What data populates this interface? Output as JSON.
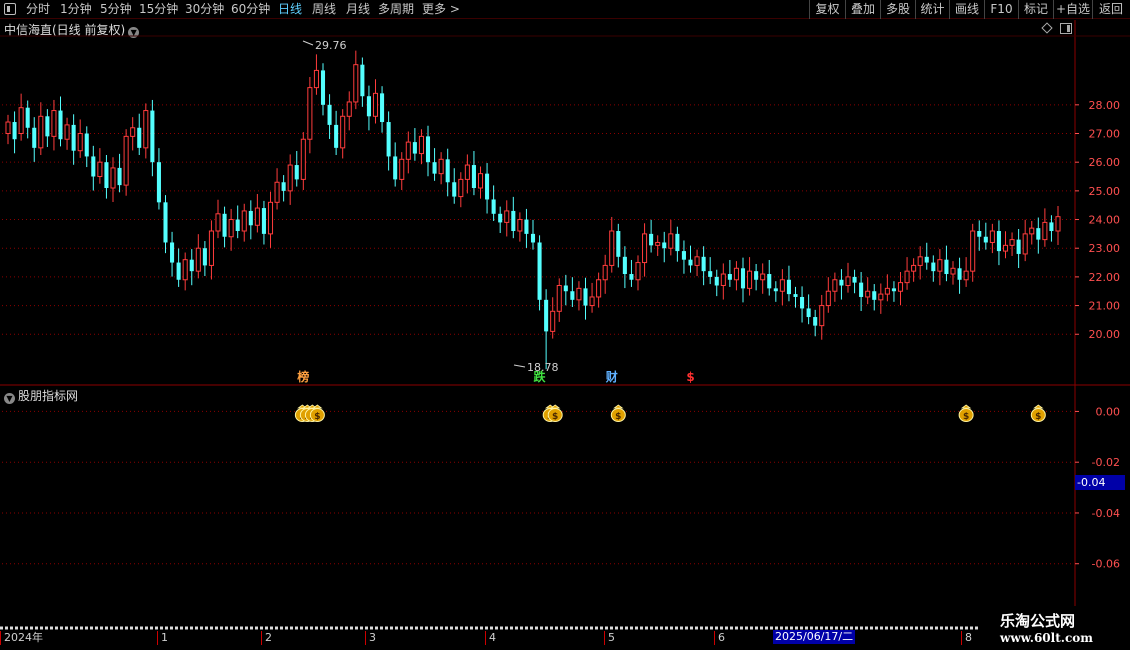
{
  "toolbar": {
    "periods": [
      "分时",
      "1分钟",
      "5分钟",
      "15分钟",
      "30分钟",
      "60分钟",
      "日线",
      "周线",
      "月线",
      "多周期",
      "更多 >"
    ],
    "active_period": "日线",
    "actions": [
      "复权",
      "叠加",
      "多股",
      "统计",
      "画线",
      "F10",
      "标记",
      "+自选",
      "返回"
    ]
  },
  "main_chart": {
    "title": "中信海直(日线 前复权)",
    "high_label": "29.76",
    "low_label": "18.78",
    "markers": [
      {
        "text": "榜",
        "color": "#ffa040"
      },
      {
        "text": "跌",
        "color": "#40e040"
      },
      {
        "text": "财",
        "color": "#5fb0ff"
      },
      {
        "text": "$",
        "color": "#ff3030"
      }
    ],
    "colors": {
      "up": "#ff3c3c",
      "down": "#54ffff",
      "grid": "#8b0000",
      "axis_text": "#ff5050"
    }
  },
  "chart_data": [
    {
      "type": "candlestick",
      "title": "中信海直(日线 前复权)",
      "yticks": [
        "20.00",
        "21.00",
        "22.00",
        "23.00",
        "24.00",
        "25.00",
        "26.00",
        "27.00",
        "28.00"
      ],
      "ylim": [
        18.3,
        30.4
      ],
      "annotations": {
        "max": 29.76,
        "min": 18.78
      },
      "close": [
        27.4,
        26.8,
        27.9,
        27.2,
        26.5,
        27.6,
        26.9,
        27.8,
        26.8,
        27.3,
        26.4,
        27.0,
        26.2,
        25.5,
        26.0,
        25.1,
        25.8,
        25.2,
        26.9,
        27.2,
        26.5,
        27.8,
        26.0,
        24.6,
        23.2,
        22.5,
        21.9,
        22.6,
        22.2,
        23.0,
        22.4,
        23.6,
        24.2,
        23.4,
        24.0,
        23.6,
        24.3,
        23.8,
        24.4,
        23.5,
        24.6,
        25.3,
        25.0,
        25.9,
        25.4,
        26.8,
        28.6,
        29.2,
        28.0,
        27.3,
        26.5,
        27.6,
        28.1,
        29.4,
        28.3,
        27.6,
        28.4,
        27.4,
        26.2,
        25.4,
        26.1,
        26.7,
        26.3,
        26.9,
        26.0,
        25.6,
        26.1,
        25.3,
        24.8,
        25.4,
        25.9,
        25.1,
        25.6,
        24.7,
        24.2,
        23.9,
        24.3,
        23.6,
        24.0,
        23.5,
        23.2,
        21.2,
        20.1,
        20.8,
        21.7,
        21.5,
        21.2,
        21.6,
        21.0,
        21.3,
        21.9,
        22.4,
        23.6,
        22.7,
        22.1,
        21.9,
        22.5,
        23.5,
        23.1,
        23.2,
        23.0,
        23.5,
        22.9,
        22.6,
        22.4,
        22.7,
        22.2,
        22.0,
        21.7,
        22.1,
        21.9,
        22.3,
        21.6,
        22.2,
        21.9,
        22.1,
        21.6,
        21.5,
        21.9,
        21.4,
        21.3,
        20.9,
        20.6,
        20.3,
        21.0,
        21.5,
        21.9,
        21.7,
        22.0,
        21.8,
        21.3,
        21.5,
        21.2,
        21.4,
        21.6,
        21.5,
        21.8,
        22.2,
        22.4,
        22.7,
        22.5,
        22.2,
        22.6,
        22.1,
        22.3,
        21.9,
        22.2,
        23.6,
        23.4,
        23.2,
        23.6,
        22.9,
        23.1,
        23.3,
        22.8,
        23.5,
        23.7,
        23.3,
        23.9,
        23.6,
        24.1
      ],
      "open": [
        27.0,
        27.4,
        27.0,
        27.9,
        27.2,
        26.5,
        27.6,
        26.9,
        27.8,
        26.8,
        27.3,
        26.4,
        27.0,
        26.2,
        25.5,
        26.0,
        25.1,
        25.8,
        25.2,
        26.9,
        27.2,
        26.5,
        27.8,
        26.0,
        24.6,
        23.2,
        22.5,
        21.9,
        22.6,
        22.2,
        23.0,
        22.4,
        23.6,
        24.2,
        23.4,
        24.0,
        23.6,
        24.3,
        23.8,
        24.4,
        23.5,
        24.6,
        25.3,
        25.0,
        25.9,
        25.4,
        26.8,
        28.6,
        29.2,
        28.0,
        27.3,
        26.5,
        27.6,
        28.1,
        29.4,
        28.3,
        27.6,
        28.4,
        27.4,
        26.2,
        25.4,
        26.1,
        26.7,
        26.3,
        26.9,
        26.0,
        25.6,
        26.1,
        25.3,
        24.8,
        25.4,
        25.9,
        25.1,
        25.6,
        24.7,
        24.2,
        23.9,
        24.3,
        23.6,
        24.0,
        23.5,
        23.2,
        21.2,
        20.1,
        20.8,
        21.7,
        21.5,
        21.2,
        21.6,
        21.0,
        21.3,
        21.9,
        22.4,
        23.6,
        22.7,
        22.1,
        21.9,
        22.5,
        23.5,
        23.1,
        23.2,
        23.0,
        23.5,
        22.9,
        22.6,
        22.4,
        22.7,
        22.2,
        22.0,
        21.7,
        22.1,
        21.9,
        22.3,
        21.6,
        22.2,
        21.9,
        22.1,
        21.6,
        21.5,
        21.9,
        21.4,
        21.3,
        20.9,
        20.6,
        20.3,
        21.0,
        21.5,
        21.9,
        21.7,
        22.0,
        21.8,
        21.3,
        21.5,
        21.2,
        21.4,
        21.6,
        21.5,
        21.8,
        22.2,
        22.4,
        22.7,
        22.5,
        22.2,
        22.6,
        22.1,
        22.3,
        21.9,
        22.2,
        23.6,
        23.4,
        23.2,
        23.6,
        22.9,
        23.1,
        23.3,
        22.8,
        23.5,
        23.7,
        23.3,
        23.9,
        23.6
      ]
    },
    {
      "type": "scatter",
      "title": "股朋指标网",
      "yticks": [
        "0.00",
        "-0.02",
        "-0.04",
        "-0.06"
      ],
      "ylim": [
        -0.0735,
        0.0045
      ],
      "current_value": "-0.04",
      "signal_icons": [
        {
          "count": 4,
          "label": "$"
        },
        {
          "count": 2,
          "label": "$"
        },
        {
          "count": 1,
          "label": "$"
        },
        {
          "count": 1,
          "label": "$"
        },
        {
          "count": 1,
          "label": "$"
        }
      ],
      "signal_positions_days": [
        46,
        83,
        93,
        146,
        157
      ]
    }
  ],
  "sub_chart": {
    "title": "股朋指标网",
    "current_value": "-0.04"
  },
  "date_axis": {
    "labels": [
      "2024年",
      "1",
      "2",
      "3",
      "4",
      "5",
      "6",
      "8"
    ],
    "cursor_date": "2025/06/17/二"
  },
  "watermark": {
    "title": "乐淘公式网",
    "url": "www.60lt.com"
  }
}
